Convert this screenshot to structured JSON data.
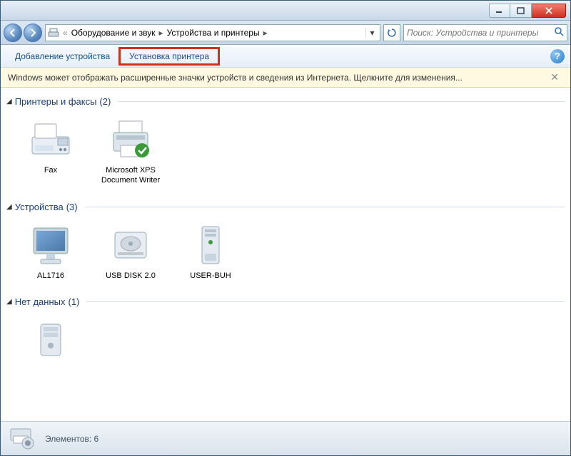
{
  "breadcrumb": {
    "item1": "Оборудование и звук",
    "item2": "Устройства и принтеры"
  },
  "search": {
    "placeholder": "Поиск: Устройства и принтеры"
  },
  "toolbar": {
    "add_device": "Добавление устройства",
    "install_printer": "Установка принтера"
  },
  "infobar": {
    "text": "Windows может отображать расширенные значки устройств и сведения из Интернета.  Щелкните для изменения..."
  },
  "groups": {
    "printers": {
      "title": "Принтеры и факсы",
      "count": "(2)"
    },
    "devices": {
      "title": "Устройства",
      "count": "(3)"
    },
    "nodata": {
      "title": "Нет данных",
      "count": "(1)"
    }
  },
  "items": {
    "fax": "Fax",
    "xps": "Microsoft XPS Document Writer",
    "monitor": "AL1716",
    "usbdisk": "USB DISK 2.0",
    "computer": "USER-BUH",
    "unknown": ""
  },
  "status": {
    "text": "Элементов: 6"
  }
}
